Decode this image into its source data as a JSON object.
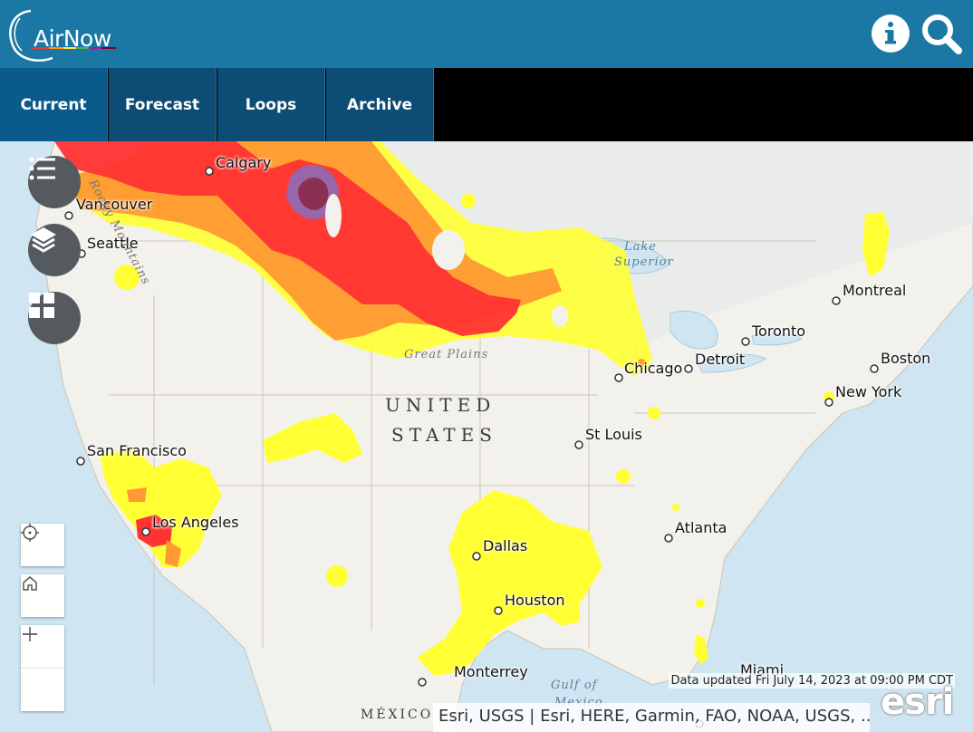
{
  "app": {
    "logo_text": "AirNow",
    "logo_colors": [
      "#e53935",
      "#ff9800",
      "#ffeb3b",
      "#4caf50",
      "#8e24aa",
      "#7e0023"
    ]
  },
  "header": {
    "buttons": [
      {
        "name": "info-button",
        "icon": "info-icon"
      },
      {
        "name": "search-button",
        "icon": "search-icon"
      }
    ]
  },
  "tabs": [
    {
      "label": "Current",
      "active": true
    },
    {
      "label": "Forecast",
      "active": false
    },
    {
      "label": "Loops",
      "active": false
    },
    {
      "label": "Archive",
      "active": false
    }
  ],
  "map": {
    "cities": [
      "Calgary",
      "Vancouver",
      "Seattle",
      "Montreal",
      "Toronto",
      "Detroit",
      "Chicago",
      "Boston",
      "New York",
      "St Louis",
      "San Francisco",
      "Los Angeles",
      "Atlanta",
      "Dallas",
      "Houston",
      "Monterrey",
      "Miami"
    ],
    "country_labels": [
      "UNITED",
      "STATES",
      "MÉXICO"
    ],
    "water_labels": [
      "Lake",
      "Superior",
      "Gulf of",
      "Mexico"
    ],
    "region_labels": [
      "Great Plains",
      "Rocky Mountains"
    ],
    "aqi_colors": {
      "good": "#ffffff",
      "moderate": "#ffff33",
      "usg": "#ff9933",
      "unhealthy": "#ff3333",
      "very_unhealthy": "#9966aa",
      "hazardous": "#8b3050"
    },
    "tools": {
      "left_buttons": [
        "legend-list-icon",
        "layers-icon",
        "basemap-grid-icon"
      ],
      "zoom_buttons": [
        "locate-icon",
        "home-icon",
        "zoom-in-icon",
        "zoom-out-icon"
      ]
    },
    "updated_text": "Data updated Fri July 14, 2023 at 09:00 PM CDT",
    "attribution": "Esri, USGS | Esri, HERE, Garmin, FAO, NOAA, USGS, ...",
    "esri_logo": "esri"
  }
}
